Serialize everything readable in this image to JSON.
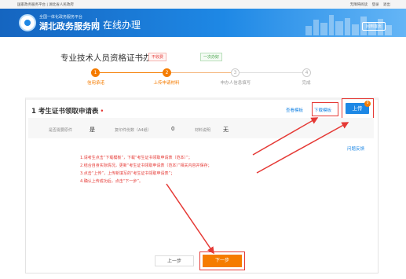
{
  "topbar": {
    "left_links": "国家政务服务平台 | 湖北省人民政府",
    "right_links": [
      "无障碍阅读",
      "登录",
      "退出"
    ]
  },
  "header": {
    "logo_small": "全国一体化政务服务平台",
    "logo_big": "湖北政务服务网",
    "section_title": "在线办理",
    "back_button": "回到首页"
  },
  "service": {
    "title": "专业技术人员资格证书办理",
    "tag_fee": "不收费",
    "tag_visits": "一次办好"
  },
  "steps": [
    {
      "num": "1",
      "label": "信用承诺",
      "active": true
    },
    {
      "num": "2",
      "label": "上传申请材料",
      "active": true
    },
    {
      "num": "3",
      "label": "申办人信息填写",
      "active": false
    },
    {
      "num": "4",
      "label": "完成",
      "active": false
    }
  ],
  "material": {
    "title": "1 考生证书领取申请表",
    "required_mark": "•",
    "view_sample": "查看模板",
    "download_template": "下载模板",
    "upload_button": "上传",
    "upload_badge": "0",
    "paper_required_label": "是否需要原件",
    "paper_required_value": "是",
    "copies_label": "复印件份数（A4纸）",
    "copies_value": "0",
    "note_label": "材料说明",
    "note_value": "无",
    "feedback_link": "问题反馈"
  },
  "instructions": [
    "1.请考生点击“下载模板”，下载“考生证书领取申请表（范本）”；",
    "2.结合自身实际情况，更新“考生证书领取申请表（范本）”相关内容并保存；",
    "3.点击“上传”，上传新填写的“考生证书领取申请表”；",
    "4.确认上传成功后，点击“下一步”。"
  ],
  "nav": {
    "prev": "上一步",
    "next": "下一步"
  },
  "colors": {
    "brand_blue": "#1e88e5",
    "accent_orange": "#f57c00",
    "annotation_red": "#e53935"
  }
}
